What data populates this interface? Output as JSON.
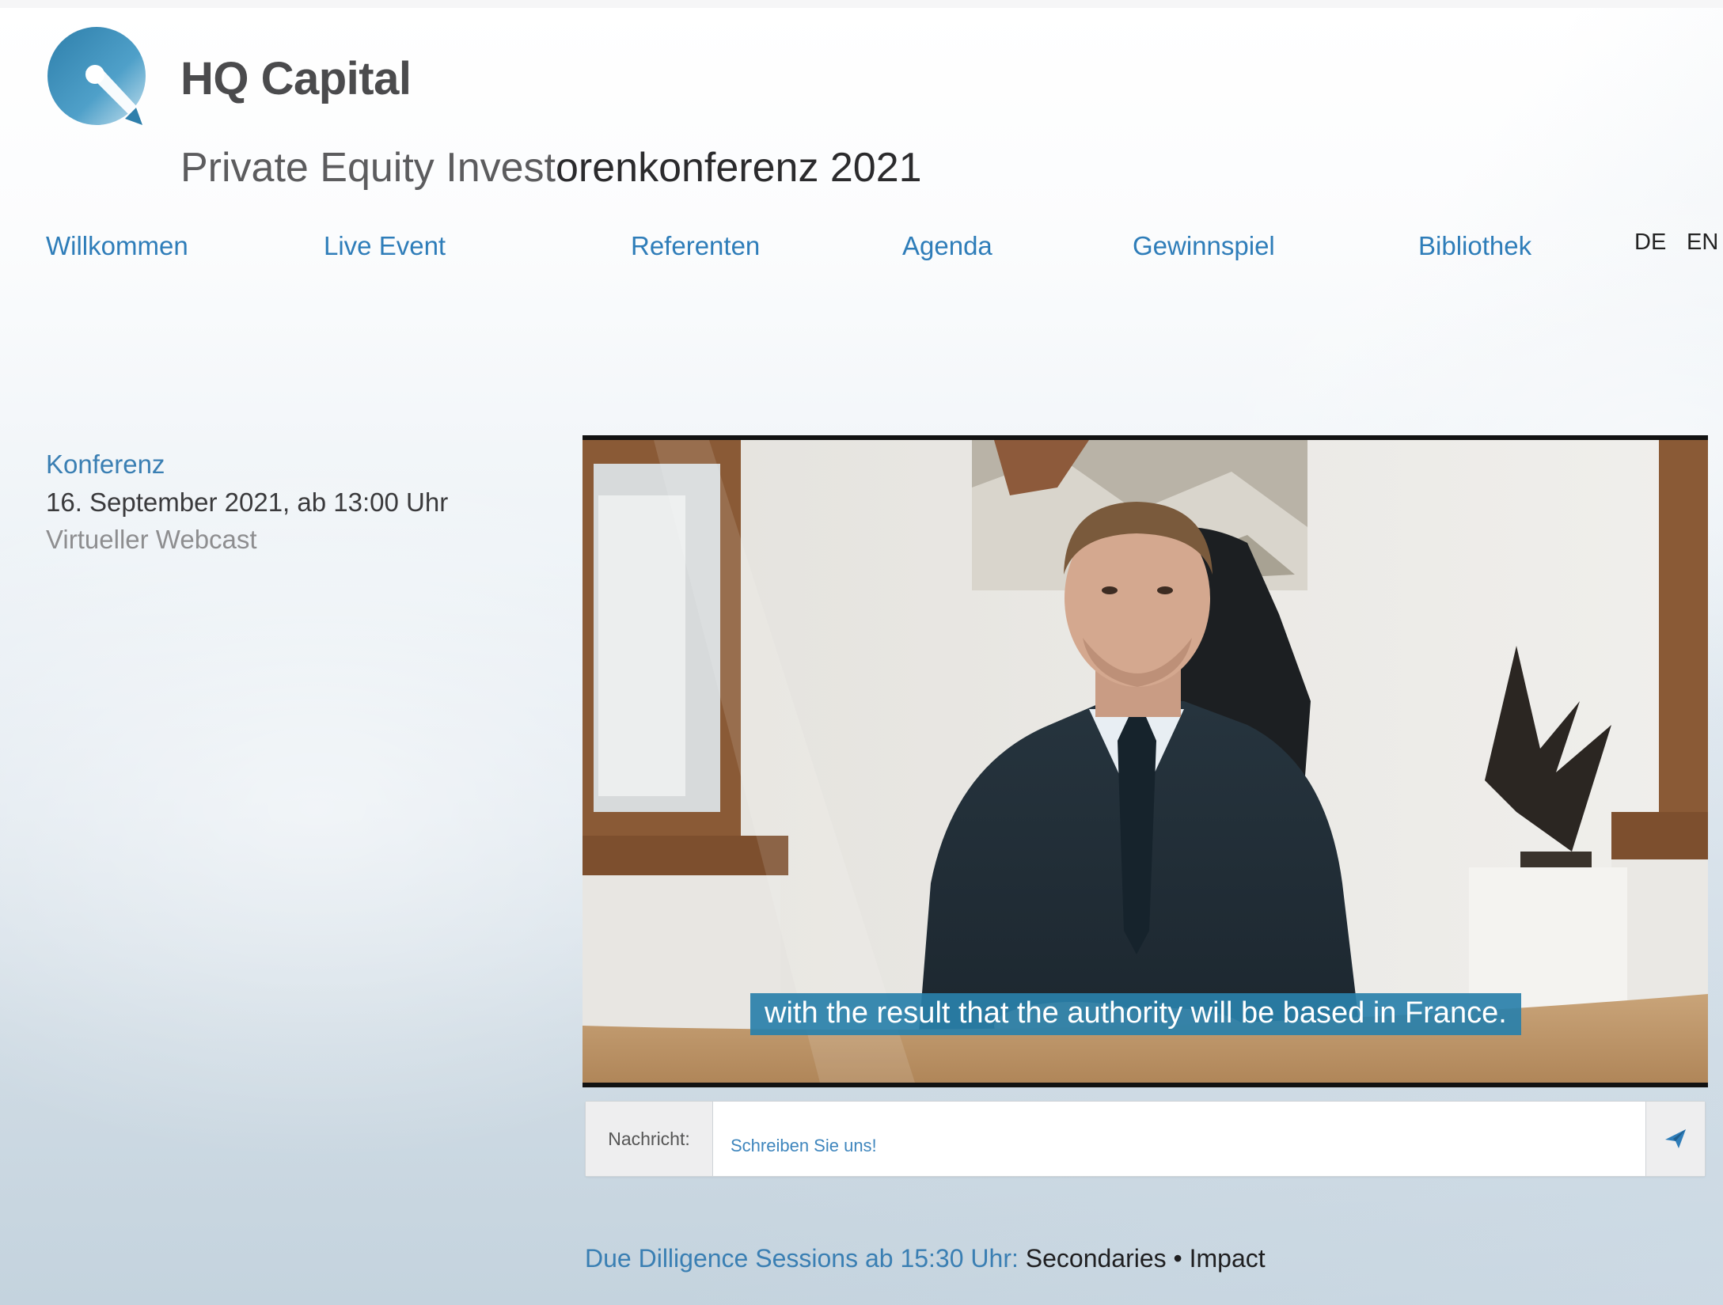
{
  "header": {
    "brand": "HQ Capital",
    "title_light": "Private Equity Invest",
    "title_dark": "orenkonferenz 2021"
  },
  "nav": {
    "items": [
      "Willkommen",
      "Live Event",
      "Referenten",
      "Agenda",
      "Gewinnspiel",
      "Bibliothek"
    ],
    "languages": [
      "DE",
      "EN"
    ]
  },
  "event": {
    "label": "Konferenz",
    "date": "16. September 2021, ab 13:00 Uhr",
    "venue": "Virtueller Webcast"
  },
  "video": {
    "subtitle": "with the result that the authority will be based in France."
  },
  "chat": {
    "label": "Nachricht:",
    "placeholder": "Schreiben Sie uns!"
  },
  "sessions": {
    "lead": "Due Dilligence Sessions ab 15:30 Uhr:",
    "tail": "Secondaries • Impact"
  },
  "colors": {
    "link": "#2e7db9",
    "subtitle_bg": "#2980aa",
    "brand_text": "#4b4b4d"
  }
}
